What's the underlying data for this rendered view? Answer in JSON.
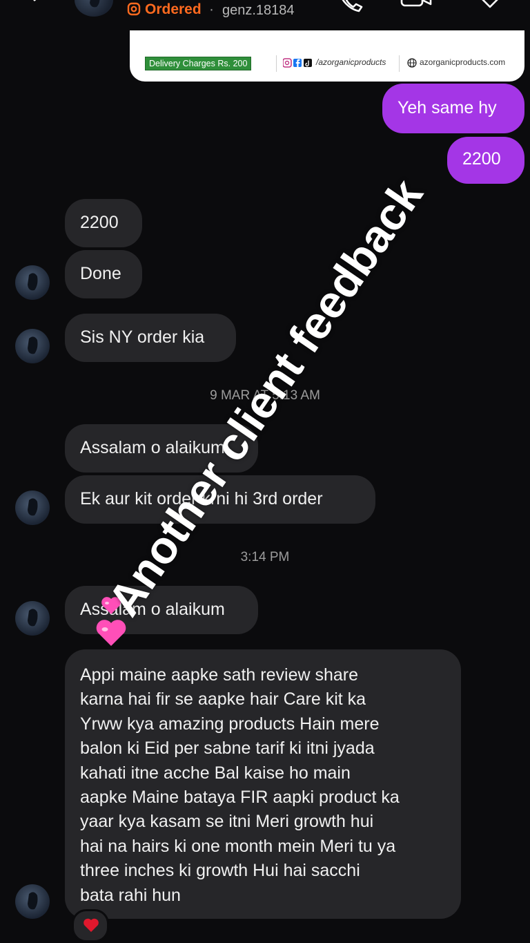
{
  "header": {
    "status_label": "Ordered",
    "separator": "·",
    "username": "genz.18184",
    "icons": [
      "back-icon",
      "phone-icon",
      "video-icon",
      "tag-icon",
      "ordered-icon"
    ]
  },
  "shared_post": {
    "delivery_charges": "Delivery Charges Rs. 200",
    "social_handle": "/azorganicproducts",
    "website": "azorganicproducts.com",
    "badge_color": "#2f8f3a"
  },
  "messages": {
    "out_1": "Yeh same hy",
    "out_2": "2200",
    "in_1": "2200",
    "in_2": "Done",
    "in_3": "Sis NY order kia",
    "timestamp_1": "9 MAR AT 5:13 AM",
    "in_4": "Assalam o alaikum",
    "in_5": "Ek aur kit order krni hi 3rd order",
    "timestamp_2": "3:14 PM",
    "in_6": "Assalam o alaikum",
    "in_7": "Appi maine aapke sath review share\nkarna hai fir se aapke hair Care kit ka\nYrww kya amazing products Hain mere\nbalon ki Eid per sabne tarif ki itni jyada\nkahati itne acche Bal kaise ho main\naapke Maine bataya FIR aapki product ka\nyaar kya kasam se itni Meri growth hui\nhai na hairs ki one month mein Meri tu ya\nthree inches ki growth Hui hai sacchi\nbata rahi hun",
    "reaction": "❤️"
  },
  "overlay_text": "Another client feedback",
  "colors": {
    "background": "#0b0b0d",
    "outgoing_bubble": "#a436e6",
    "incoming_bubble": "#262629",
    "ordered_accent": "#ff6a1f"
  }
}
